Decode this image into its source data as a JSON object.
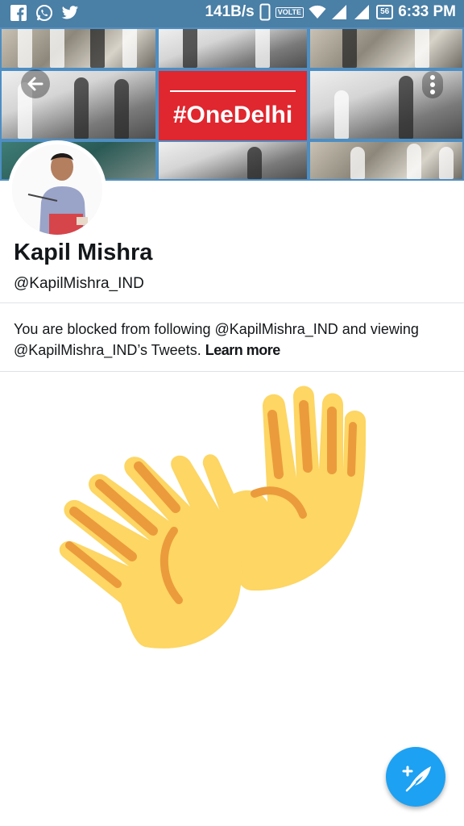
{
  "status_bar": {
    "apps": [
      "facebook-icon",
      "whatsapp-icon",
      "twitter-icon"
    ],
    "speed": "141B/s",
    "volte": "VOLTE",
    "battery": "56",
    "time": "6:33 PM"
  },
  "banner": {
    "hashtag": "#OneDelhi"
  },
  "profile": {
    "name": "Kapil Mishra",
    "handle": "@KapilMishra_IND"
  },
  "blocked_notice": {
    "text": "You are blocked from following @KapilMishra_IND and viewing @KapilMishra_IND’s Tweets.",
    "link": "Learn more"
  },
  "colors": {
    "accent": "#1da1f2",
    "status_bar": "#4a7fa6",
    "hashtag_red": "#e0262e",
    "hand_yellow": "#fdd663",
    "hand_orange": "#eb9b3c"
  }
}
